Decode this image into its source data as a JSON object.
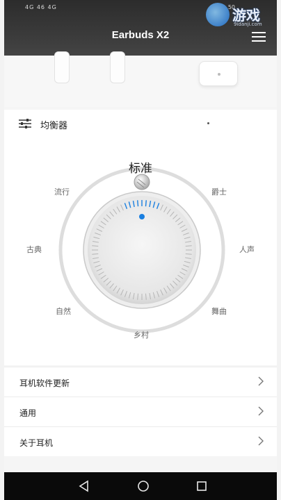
{
  "status_bar": {
    "left": "4G 46 4G",
    "right": "50"
  },
  "watermark": {
    "brand": "游戏",
    "site": "9idanji.com"
  },
  "header": {
    "title": "Earbuds X2"
  },
  "equalizer": {
    "label": "均衡器",
    "current_mode": "标准",
    "presets": {
      "pop": "流行",
      "jazz": "爵士",
      "classical": "古典",
      "vocal": "人声",
      "natural": "自然",
      "dance": "舞曲",
      "country": "乡村"
    }
  },
  "settings_list": [
    {
      "label": "耳机软件更新"
    },
    {
      "label": "通用"
    },
    {
      "label": "关于耳机"
    }
  ],
  "colors": {
    "accent": "#1a7fe0",
    "header_bg": "#333333",
    "navbar_bg": "#0a0a0a"
  },
  "icons": {
    "menu": "hamburger-menu-icon",
    "equalizer": "sliders-icon",
    "chevron": "chevron-right-icon",
    "nav_back": "triangle-back-icon",
    "nav_home": "circle-home-icon",
    "nav_recent": "square-recent-icon"
  }
}
